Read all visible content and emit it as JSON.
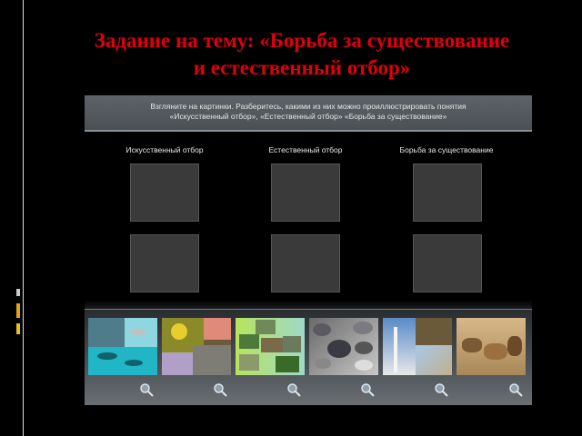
{
  "slide": {
    "title_line1": "Задание на тему: «Борьба за существование",
    "title_line2": "и естественный отбор»"
  },
  "task": {
    "instruction_line1": "Взгляните на картинки. Разберитесь, какими из них можно проиллюстрировать понятия",
    "instruction_line2": "«Искусственный отбор», «Естественный отбор» «Борьба за существование»"
  },
  "columns": [
    {
      "label": "Искусственный отбор"
    },
    {
      "label": "Естественный отбор"
    },
    {
      "label": "Борьба за существование"
    }
  ],
  "gallery": {
    "thumbnails": [
      {
        "subject": "fish",
        "icon": "zoom-icon"
      },
      {
        "subject": "flowers",
        "icon": "zoom-icon"
      },
      {
        "subject": "plants",
        "icon": "zoom-icon"
      },
      {
        "subject": "pigeons",
        "icon": "zoom-icon"
      },
      {
        "subject": "birch-moths",
        "icon": "zoom-icon"
      },
      {
        "subject": "lions-antelope",
        "icon": "zoom-icon"
      }
    ]
  },
  "colors": {
    "title": "#e0000c",
    "panel_header": "#555a5f",
    "slot": "#3a3a3a"
  }
}
